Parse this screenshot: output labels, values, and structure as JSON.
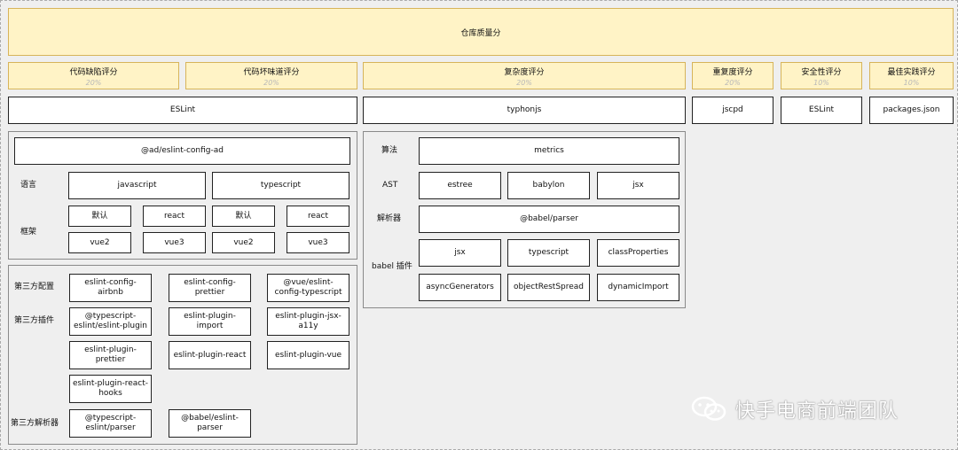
{
  "root": {
    "title": "仓库质量分"
  },
  "scores": [
    {
      "label": "代码缺陷评分",
      "weight": "20%"
    },
    {
      "label": "代码坏味道评分",
      "weight": "20%"
    },
    {
      "label": "复杂度评分",
      "weight": "20%"
    },
    {
      "label": "重复度评分",
      "weight": "20%"
    },
    {
      "label": "安全性评分",
      "weight": "10%"
    },
    {
      "label": "最佳实践评分",
      "weight": "10%"
    }
  ],
  "tools": [
    "ESLint",
    "typhonjs",
    "jscpd",
    "ESLint",
    "packages.json"
  ],
  "eslint_group": {
    "config": "@ad/eslint-config-ad",
    "language_label": "语言",
    "languages": [
      "javascript",
      "typescript"
    ],
    "framework_label": "框架",
    "frameworks": [
      "默认",
      "react",
      "默认",
      "react",
      "vue2",
      "vue3",
      "vue2",
      "vue3"
    ]
  },
  "third_party": {
    "config_label": "第三方配置",
    "configs": [
      "eslint-config-airbnb",
      "eslint-config-prettier",
      "@vue/eslint-config-typescript"
    ],
    "plugin_label": "第三方插件",
    "plugins": [
      "@typescript-eslint/eslint-plugin",
      "eslint-plugin-import",
      "eslint-plugin-jsx-a11y",
      "eslint-plugin-prettier",
      "eslint-plugin-react",
      "eslint-plugin-vue",
      "eslint-plugin-react-hooks"
    ],
    "parser_label": "第三方解析器",
    "parsers": [
      "@typescript-eslint/parser",
      "@babel/eslint-parser"
    ]
  },
  "complexity_group": {
    "algo_label": "算法",
    "algo": "metrics",
    "ast_label": "AST",
    "asts": [
      "estree",
      "babylon",
      "jsx"
    ],
    "parser_label": "解析器",
    "parser": "@babel/parser",
    "plugins_label": "babel 插件",
    "plugins": [
      "jsx",
      "typescript",
      "classProperties",
      "asyncGenerators",
      "objectRestSpread",
      "dynamicImport"
    ]
  },
  "watermark": {
    "text": "快手电商前端团队"
  }
}
